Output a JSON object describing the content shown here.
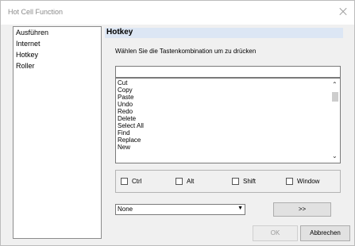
{
  "window": {
    "title": "Hot Cell Function"
  },
  "nav": {
    "items": [
      "Ausführen",
      "Internet",
      "Hotkey",
      "Roller"
    ]
  },
  "panel": {
    "header": "Hotkey",
    "description": "Wählen Sie die Tastenkombination um zu drücken",
    "input_value": "",
    "list_items": [
      "Cut",
      "Copy",
      "Paste",
      "Undo",
      "Redo",
      "Delete",
      "Select All",
      "Find",
      "Replace",
      "New"
    ],
    "modifiers": [
      "Ctrl",
      "Alt",
      "Shift",
      "Window"
    ],
    "key_select_value": "None",
    "more_button": ">>"
  },
  "footer": {
    "ok_label": "OK",
    "cancel_label": "Abbrechen"
  }
}
